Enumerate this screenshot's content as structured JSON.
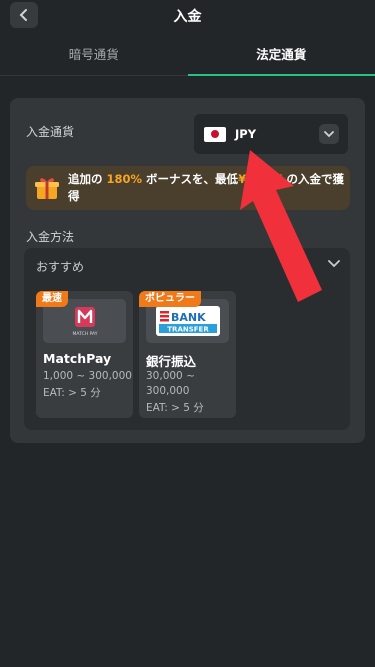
{
  "header": {
    "title": "入金"
  },
  "tabs": [
    {
      "label": "暗号通貨",
      "active": false
    },
    {
      "label": "法定通貨",
      "active": true
    }
  ],
  "currency": {
    "label": "入金通貨",
    "selected": "JPY",
    "flag_icon": "japan-flag-icon"
  },
  "bonus": {
    "prefix": "追加の ",
    "percent": "180%",
    "middle": " ボーナスを、最低",
    "amount": "¥7,337",
    "suffix": " の入金で獲得"
  },
  "methods": {
    "label": "入金方法",
    "section": "おすすめ",
    "cards": [
      {
        "badge": "最速",
        "name": "MatchPay",
        "range": "1,000 ~ 300,000",
        "eta": "EAT: > 5 分",
        "logo_text": "MATCH PAY"
      },
      {
        "badge": "ポピュラー",
        "name": "銀行振込",
        "range_line1": "30,000 ~",
        "range_line2": "300,000",
        "eta": "EAT: > 5 分",
        "logo_text1": "BANK",
        "logo_text2": "TRANSFER"
      }
    ]
  },
  "colors": {
    "accent": "#27c281",
    "orange": "#f5a623",
    "badge": "#f07a1a",
    "arrow": "#f0303a"
  }
}
